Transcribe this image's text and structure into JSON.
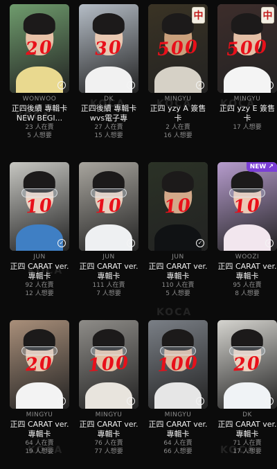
{
  "watermark": "KOCA",
  "cards": [
    {
      "member": "WONWOO",
      "title": "正四後續 專輯卡 NEW BEGI...",
      "owned": "23 人在賣",
      "wanted": "5 人想要",
      "price": "20",
      "colors": {
        "bg": "#6f9c6d",
        "skin": "#e7c2a8",
        "body": "#e9d98f"
      },
      "mahjong": "",
      "badge": ""
    },
    {
      "member": "DK",
      "title": "正四後續 專輯卡 wvs電子專",
      "owned": "27 人在賣",
      "wanted": "15 人想要",
      "price": "30",
      "colors": {
        "bg": "#b5bdc6",
        "skin": "#e8c8b2",
        "body": "#f1f1f1"
      },
      "mahjong": "",
      "badge": ""
    },
    {
      "member": "MINGYU",
      "title": "正四 yzy A 簽售卡",
      "owned": "2 人在賣",
      "wanted": "16 人想要",
      "price": "500",
      "colors": {
        "bg": "#3a3324",
        "skin": "#c9a07c",
        "body": "#d6d1c6"
      },
      "mahjong": "中",
      "badge": ""
    },
    {
      "member": "MINGYU",
      "title": "正四 yzy E 簽售卡",
      "owned": "",
      "wanted": "17 人想要",
      "price": "500",
      "colors": {
        "bg": "#3d2d2b",
        "skin": "#e3bfa6",
        "body": "#f4f4f4"
      },
      "mahjong": "中",
      "badge": ""
    },
    {
      "member": "JUN",
      "title": "正四 CARAT ver. 專輯卡",
      "owned": "92 人在賣",
      "wanted": "12 人想要",
      "price": "10",
      "colors": {
        "bg": "#c7c7c2",
        "skin": "#ecd3c3",
        "body": "#3f7fc4"
      },
      "mahjong": "",
      "badge": ""
    },
    {
      "member": "JUN",
      "title": "正四 CARAT ver. 專輯卡",
      "owned": "111 人在賣",
      "wanted": "7 人想要",
      "price": "10",
      "colors": {
        "bg": "#a8a59e",
        "skin": "#e8cfbe",
        "body": "#eef0f2"
      },
      "mahjong": "",
      "badge": ""
    },
    {
      "member": "JUN",
      "title": "正四 CARAT ver. 專輯卡",
      "owned": "110 人在賣",
      "wanted": "5 人想要",
      "price": "10",
      "colors": {
        "bg": "#2b3226",
        "skin": "#d3a98a",
        "body": "#101214"
      },
      "mahjong": "",
      "badge": ""
    },
    {
      "member": "WOOZI",
      "title": "正四 CARAT ver. 專輯卡",
      "owned": "95 人在賣",
      "wanted": "8 人想要",
      "price": "10",
      "colors": {
        "bg": "#b69ccd",
        "skin": "#ecc9b5",
        "body": "#f2e6ee"
      },
      "mahjong": "",
      "badge": "NEW ↗"
    },
    {
      "member": "MINGYU",
      "title": "正四 CARAT ver. 專輯卡",
      "owned": "64 人在賣",
      "wanted": "19 人想要",
      "price": "20",
      "colors": {
        "bg": "#a98f7a",
        "skin": "#e7c7b0",
        "body": "#f3f3f3"
      },
      "mahjong": "",
      "badge": ""
    },
    {
      "member": "MINGYU",
      "title": "正四 CARAT ver. 專輯卡",
      "owned": "76 人在賣",
      "wanted": "77 人想要",
      "price": "100",
      "colors": {
        "bg": "#8e8c88",
        "skin": "#e3c1a6",
        "body": "#e8e4dd"
      },
      "mahjong": "",
      "badge": ""
    },
    {
      "member": "MINGYU",
      "title": "正四 CARAT ver. 專輯卡",
      "owned": "64 人在賣",
      "wanted": "66 人想要",
      "price": "100",
      "colors": {
        "bg": "#7a7f86",
        "skin": "#dcb79e",
        "body": "#e6e6e6"
      },
      "mahjong": "",
      "badge": ""
    },
    {
      "member": "DK",
      "title": "正四 CARAT ver. 專輯卡",
      "owned": "71 人在賣",
      "wanted": "17 人想要",
      "price": "20",
      "colors": {
        "bg": "#d5d4cf",
        "skin": "#ead1bf",
        "body": "#f0f3f6"
      },
      "mahjong": "",
      "badge": ""
    }
  ]
}
